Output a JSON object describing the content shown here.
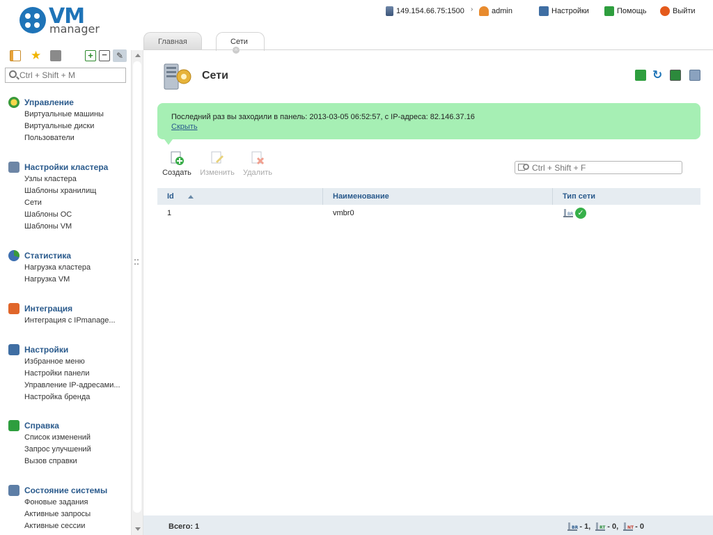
{
  "brand": {
    "vm": "VM",
    "manager": "manager"
  },
  "topbar": {
    "host": "149.154.66.75:1500",
    "user": "admin",
    "settings": "Настройки",
    "help": "Помощь",
    "exit": "Выйти"
  },
  "tabs": [
    {
      "label": "Главная"
    },
    {
      "label": "Сети"
    }
  ],
  "sidebar": {
    "search_placeholder": "Ctrl + Shift + M",
    "groups": [
      {
        "title": "Управление",
        "items": [
          "Виртуальные машины",
          "Виртуальные диски",
          "Пользователи"
        ]
      },
      {
        "title": "Настройки кластера",
        "items": [
          "Узлы кластера",
          "Шаблоны хранилищ",
          "Сети",
          "Шаблоны ОС",
          "Шаблоны VM"
        ]
      },
      {
        "title": "Статистика",
        "items": [
          "Нагрузка кластера",
          "Нагрузка VM"
        ]
      },
      {
        "title": "Интеграция",
        "items": [
          "Интеграция с IPmanage..."
        ]
      },
      {
        "title": "Настройки",
        "items": [
          "Избранное меню",
          "Настройки панели",
          "Управление IP-адресами...",
          "Настройка бренда"
        ]
      },
      {
        "title": "Справка",
        "items": [
          "Список изменений",
          "Запрос улучшений",
          "Вызов справки"
        ]
      },
      {
        "title": "Состояние системы",
        "items": [
          "Фоновые задания",
          "Активные запросы",
          "Активные сессии"
        ]
      }
    ]
  },
  "page": {
    "title": "Сети",
    "notice": "Последний раз вы заходили в панель: 2013-03-05 06:52:57, с IP-адреса: 82.146.37.16",
    "hide_link": "Скрыть",
    "actions": {
      "create": "Создать",
      "edit": "Изменить",
      "delete": "Удалить"
    },
    "grid_search_placeholder": "Ctrl + Shift + F"
  },
  "table": {
    "columns": [
      "Id",
      "Наименование",
      "Тип сети"
    ],
    "rows": [
      {
        "id": "1",
        "name": "vmbr0"
      }
    ]
  },
  "footer": {
    "total": "Всего: 1",
    "br": "- 1,",
    "rt": "- 0,",
    "nt": "- 0"
  },
  "colors": {
    "accent": "#2a5a8c",
    "notice_bg": "#a6efb4",
    "status_ok": "#37b04a"
  },
  "icons": {
    "page": "network-server-icon",
    "status": "check-icon",
    "net_types": [
      "bridge-br-icon",
      "router-rt-icon",
      "nat-nt-icon"
    ]
  }
}
